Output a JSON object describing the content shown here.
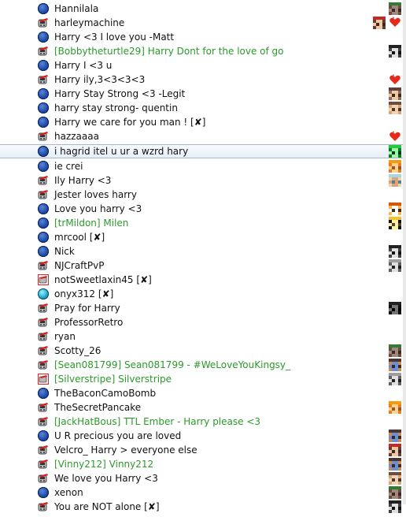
{
  "users": [
    {
      "name": "Hannilala",
      "icon": "online-circle-icon",
      "avatar": "green-skin"
    },
    {
      "name": "harleymachine",
      "icon": "phone-icon",
      "avatar": "red-skin",
      "avatar2": "multi-skin",
      "badge": "heart-badge-icon"
    },
    {
      "name": "Harry <3 I love you -Matt",
      "icon": "online-circle-icon"
    },
    {
      "name": "[Bobbytheturtle29] Harry Dont for the love of go",
      "icon": "phone-icon",
      "color": "green",
      "avatar": "dark-skin"
    },
    {
      "name": "Harry I <3 u",
      "icon": "online-circle-icon"
    },
    {
      "name": "Harry ily,3<3<3<3",
      "icon": "phone-icon",
      "badge": "heart-badge-icon"
    },
    {
      "name": "Harry Stay Strong <3 -Legit",
      "icon": "online-circle-icon",
      "avatar": "brown-skin"
    },
    {
      "name": "harry stay strong- quentin",
      "icon": "online-circle-icon",
      "avatar": "tan-skin"
    },
    {
      "name": "Harry we care for you man ! [",
      "suffix": "]",
      "x": "✘",
      "icon": "online-circle-icon"
    },
    {
      "name": "hazzaaaa",
      "icon": "phone-icon",
      "badge": "heart-badge-icon"
    },
    {
      "name": "i hagrid itel u ur a wzrd hary",
      "icon": "online-circle-icon",
      "avatar": "creeper-skin",
      "selected": true
    },
    {
      "name": "ie crei",
      "icon": "online-circle-icon",
      "avatar": "orange-skin"
    },
    {
      "name": "Ily Harry <3",
      "icon": "phone-icon",
      "avatar": "cyan-skin"
    },
    {
      "name": "Jester loves harry",
      "icon": "phone-icon"
    },
    {
      "name": "Love you harry <3",
      "icon": "online-circle-icon",
      "avatar": "fox-skin"
    },
    {
      "name": "[trMildon] Milen",
      "icon": "online-circle-icon",
      "color": "green",
      "avatar": "yellow-skin"
    },
    {
      "name": "mrcool [",
      "suffix": "]",
      "x": "✘",
      "icon": "online-circle-icon"
    },
    {
      "name": "Nick",
      "icon": "online-circle-icon",
      "avatar": "dark-skin"
    },
    {
      "name": "NJCraftPvP",
      "icon": "phone-icon",
      "avatar": "grey-skin"
    },
    {
      "name": "notSweetlaxin45 [",
      "suffix": "]",
      "x": "✘",
      "icon": "phone-red-icon"
    },
    {
      "name": "onyx312 [",
      "suffix": "]",
      "x": "✘",
      "icon": "online-circle-cyan-icon"
    },
    {
      "name": "Pray for Harry",
      "icon": "phone-icon",
      "avatar": "black-skin"
    },
    {
      "name": "ProfessorRetro",
      "icon": "phone-icon"
    },
    {
      "name": "ryan",
      "icon": "phone-icon"
    },
    {
      "name": "Scotty_26",
      "icon": "phone-icon",
      "avatar": "green-skin"
    },
    {
      "name": "[Sean081799] Sean081799 - #WeLoveYouKingsy_",
      "icon": "phone-icon",
      "color": "green",
      "avatar": "steve-skin"
    },
    {
      "name": "[Silverstripe] Silverstripe",
      "icon": "phone-red-icon",
      "color": "green",
      "avatar": "grey-skin"
    },
    {
      "name": "TheBaconCamoBomb",
      "icon": "online-circle-icon"
    },
    {
      "name": "TheSecretPancake",
      "icon": "phone-icon",
      "avatar": "orange-skin"
    },
    {
      "name": "[JackHatBous] TTL Ember - Harry please <3",
      "icon": "phone-icon",
      "color": "green"
    },
    {
      "name": "U R precious you are loved",
      "icon": "online-circle-icon",
      "avatar": "steve-skin"
    },
    {
      "name": "Velcro_ Harry > everyone else",
      "icon": "phone-icon",
      "avatar": "red-skin"
    },
    {
      "name": "[Vinny212] Vinny212",
      "icon": "phone-icon",
      "color": "green",
      "avatar": "steve-skin"
    },
    {
      "name": "We love you Harry <3",
      "icon": "phone-icon",
      "avatar": "tan-skin"
    },
    {
      "name": "xenon",
      "icon": "online-circle-icon",
      "avatar": "green-skin"
    },
    {
      "name": "You are NOT alone [",
      "suffix": "]",
      "x": "✘",
      "icon": "phone-icon",
      "avatar": "dark-skin"
    }
  ],
  "colors": {
    "green_name": "#2a9a2a",
    "selection_border": "#a9b8cc",
    "heart": "#e52a1a"
  }
}
